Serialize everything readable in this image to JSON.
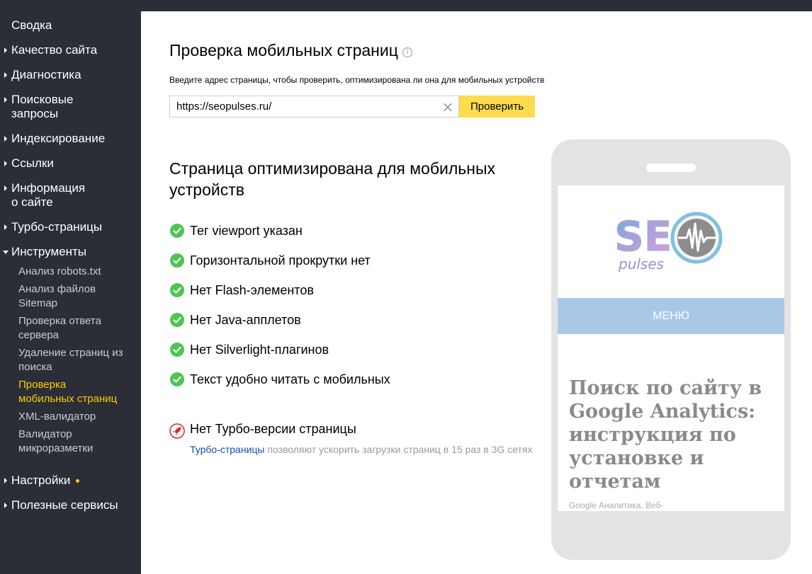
{
  "sidebar": {
    "items": [
      {
        "label": "Сводка"
      },
      {
        "label": "Качество сайта"
      },
      {
        "label": "Диагностика"
      },
      {
        "label": "Поисковые запросы"
      },
      {
        "label": "Индексирование"
      },
      {
        "label": "Ссылки"
      },
      {
        "label": "Информация о сайте"
      },
      {
        "label": "Турбо-страницы"
      },
      {
        "label": "Инструменты"
      },
      {
        "label": "Настройки"
      },
      {
        "label": "Полезные сервисы"
      }
    ],
    "line_breaks": {
      "search_l1": "Поисковые",
      "search_l2": "запросы",
      "info_l1": "Информация",
      "info_l2": "о сайте"
    },
    "tools": [
      {
        "label": "Анализ robots.txt"
      },
      {
        "label_l1": "Анализ файлов",
        "label_l2": "Sitemap"
      },
      {
        "label_l1": "Проверка ответа",
        "label_l2": "сервера"
      },
      {
        "label_l1": "Удаление страниц из",
        "label_l2": "поиска"
      },
      {
        "label_l1": "Проверка",
        "label_l2": "мобильных страниц"
      },
      {
        "label": "XML-валидатор"
      },
      {
        "label_l1": "Валидатор",
        "label_l2": "микроразметки"
      }
    ]
  },
  "main": {
    "title": "Проверка мобильных страниц",
    "hint": "Введите адрес страницы, чтобы проверить, оптимизирована ли она для мобильных устройств",
    "url_value": "https://seopulses.ru/",
    "check_button": "Проверить",
    "result_title": "Страница оптимизирована для мобильных устройств",
    "checks": [
      "Тег viewport указан",
      "Горизонтальной прокрутки нет",
      "Нет Flash-элементов",
      "Нет Java-апплетов",
      "Нет Silverlight-плагинов",
      "Текст удобно читать с мобильных"
    ],
    "turbo": {
      "title": "Нет Турбо-версии страницы",
      "link": "Турбо-страницы",
      "desc": " позволяют ускорить загрузки страниц в 15 раз в 3G сетях"
    }
  },
  "preview": {
    "logo_text_big": "SE",
    "logo_text_small": "pulses",
    "menu": "МЕНЮ",
    "article_title": "Поиск по сайту в Google Analytics: инструкция по установке и отчетам",
    "article_meta": "Google Аналитика, Веб-"
  },
  "colors": {
    "sidebar_bg": "#2b2e36",
    "active": "#ffcc00",
    "button": "#ffdb4d",
    "ok": "#4cc552",
    "turbo_icon": "#e0252b",
    "link": "#1a4ba6"
  }
}
